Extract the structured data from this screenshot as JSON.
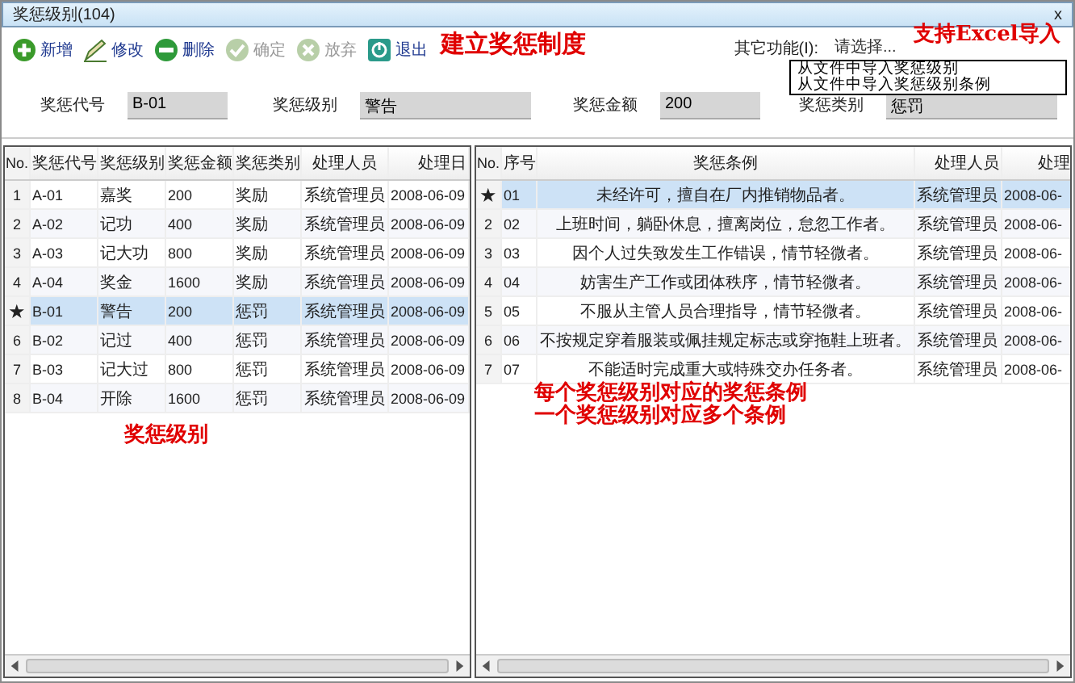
{
  "window": {
    "title": "奖惩级别(104)",
    "close": "x"
  },
  "toolbar": [
    {
      "kind": "add",
      "label": "新增",
      "disabled": false
    },
    {
      "kind": "edit",
      "label": "修改",
      "disabled": false
    },
    {
      "kind": "delete",
      "label": "删除",
      "disabled": false
    },
    {
      "kind": "confirm",
      "label": "确定",
      "disabled": true
    },
    {
      "kind": "cancel",
      "label": "放弃",
      "disabled": true
    },
    {
      "kind": "exit",
      "label": "退出",
      "disabled": false
    }
  ],
  "other_functions": {
    "label": "其它功能(I):",
    "value": "请选择...",
    "options": [
      "从文件中导入奖惩级别",
      "从文件中导入奖惩级别条例"
    ]
  },
  "fields": [
    {
      "label": "奖惩代号",
      "value": "B-01"
    },
    {
      "label": "奖惩级别",
      "value": "警告"
    },
    {
      "label": "奖惩金额",
      "value": "200"
    },
    {
      "label": "奖惩类别",
      "value": "惩罚"
    }
  ],
  "levels_table": {
    "columns": [
      "No.",
      "奖惩代号",
      "奖惩级别",
      "奖惩金额",
      "奖惩类别",
      "处理人员",
      "处理日"
    ],
    "rows": [
      {
        "selected": false,
        "cells": [
          "1",
          "A-01",
          "嘉奖",
          "200",
          "奖励",
          "系统管理员",
          "2008-06-09"
        ]
      },
      {
        "selected": false,
        "cells": [
          "2",
          "A-02",
          "记功",
          "400",
          "奖励",
          "系统管理员",
          "2008-06-09"
        ]
      },
      {
        "selected": false,
        "cells": [
          "3",
          "A-03",
          "记大功",
          "800",
          "奖励",
          "系统管理员",
          "2008-06-09"
        ]
      },
      {
        "selected": false,
        "cells": [
          "4",
          "A-04",
          "奖金",
          "1600",
          "奖励",
          "系统管理员",
          "2008-06-09"
        ]
      },
      {
        "selected": true,
        "cells": [
          "★",
          "B-01",
          "警告",
          "200",
          "惩罚",
          "系统管理员",
          "2008-06-09"
        ]
      },
      {
        "selected": false,
        "cells": [
          "6",
          "B-02",
          "记过",
          "400",
          "惩罚",
          "系统管理员",
          "2008-06-09"
        ]
      },
      {
        "selected": false,
        "cells": [
          "7",
          "B-03",
          "记大过",
          "800",
          "惩罚",
          "系统管理员",
          "2008-06-09"
        ]
      },
      {
        "selected": false,
        "cells": [
          "8",
          "B-04",
          "开除",
          "1600",
          "惩罚",
          "系统管理员",
          "2008-06-09"
        ]
      }
    ]
  },
  "rules_table": {
    "columns": [
      "No.",
      "序号",
      "奖惩条例",
      "处理人员",
      "处理"
    ],
    "rows": [
      {
        "selected": true,
        "cells": [
          "★",
          "01",
          "未经许可，擅自在厂内推销物品者。",
          "系统管理员",
          "2008-06-"
        ]
      },
      {
        "selected": false,
        "cells": [
          "2",
          "02",
          "上班时间，躺卧休息，擅离岗位，怠忽工作者。",
          "系统管理员",
          "2008-06-"
        ]
      },
      {
        "selected": false,
        "cells": [
          "3",
          "03",
          "因个人过失致发生工作错误，情节轻微者。",
          "系统管理员",
          "2008-06-"
        ]
      },
      {
        "selected": false,
        "cells": [
          "4",
          "04",
          "妨害生产工作或团体秩序，情节轻微者。",
          "系统管理员",
          "2008-06-"
        ]
      },
      {
        "selected": false,
        "cells": [
          "5",
          "05",
          "不服从主管人员合理指导，情节轻微者。",
          "系统管理员",
          "2008-06-"
        ]
      },
      {
        "selected": false,
        "cells": [
          "6",
          "06",
          "不按规定穿着服装或佩挂规定标志或穿拖鞋上班者。",
          "系统管理员",
          "2008-06-"
        ]
      },
      {
        "selected": false,
        "cells": [
          "7",
          "07",
          "不能适时完成重大或特殊交办任务者。",
          "系统管理员",
          "2008-06-"
        ]
      }
    ]
  },
  "annotations": [
    {
      "kind": "toolbar",
      "text": "建立奖惩制度"
    },
    {
      "kind": "import",
      "text": "支持Excel导入"
    },
    {
      "kind": "left",
      "text": "奖惩级别"
    },
    {
      "kind": "right",
      "text": "每个奖惩级别对应的奖惩条例"
    },
    {
      "kind": "right2",
      "text": "一个奖惩级别对应多个条例"
    }
  ]
}
